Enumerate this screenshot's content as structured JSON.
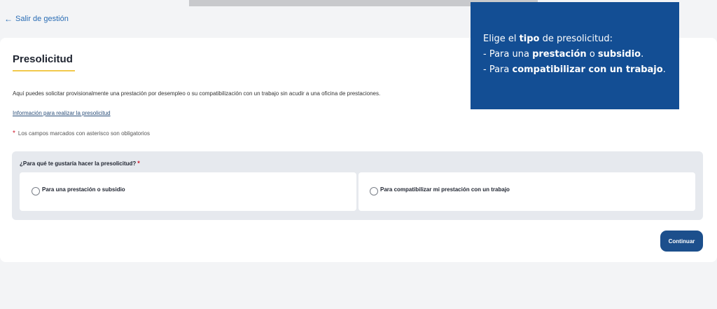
{
  "nav": {
    "back_arrow": "←",
    "back_label": "Salir de gestión"
  },
  "page": {
    "title": "Presolicitud",
    "intro": "Aquí puedes solicitar provisionalmente una prestación por desempleo o su compatibilización con un trabajo sin acudir a una oficina de prestaciones.",
    "info_link": "Información para realizar la presolicitud",
    "required_star": "*",
    "required_note": "Los campos marcados con asterisco son obligatorios"
  },
  "question": {
    "label": "¿Para qué te gustaría hacer la presolicitud?",
    "star": "*",
    "options": [
      {
        "label": "Para una prestación o subsidio",
        "selected": false
      },
      {
        "label": "Para compatibilizar mi prestación con un trabajo",
        "selected": false
      }
    ]
  },
  "actions": {
    "continue_label": "Continuar"
  },
  "tooltip": {
    "line1_pre": "Elige el ",
    "line1_bold": "tipo",
    "line1_post": " de presolicitud:",
    "line2_pre": "- Para una ",
    "line2_bold1": "prestación",
    "line2_mid": " o ",
    "line2_bold2": "subsidio",
    "line2_post": ".",
    "line3_pre": "- Para ",
    "line3_bold": "compatibilizar con un trabajo",
    "line3_post": "."
  },
  "colors": {
    "accent_blue": "#1c4f8c",
    "tooltip_blue": "#134e94",
    "link_blue": "#2a6db5",
    "required_red": "#d0182b",
    "title_underline": "#f2c94c"
  }
}
